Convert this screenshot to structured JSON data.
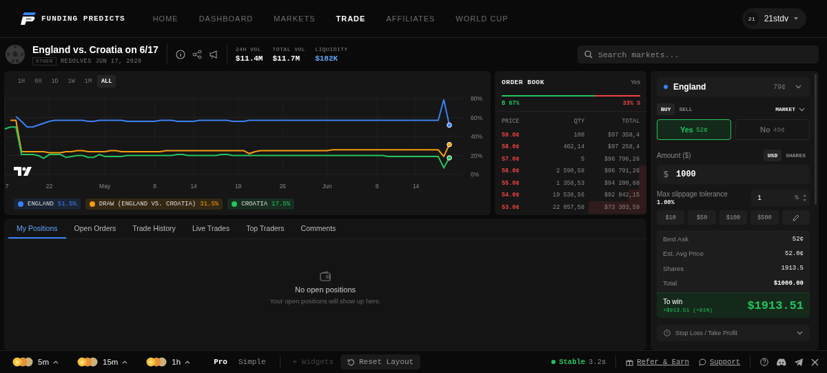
{
  "nav": {
    "brand": "FUNDING PREDICTS",
    "items": [
      {
        "label": "HOME",
        "selected": false
      },
      {
        "label": "DASHBOARD",
        "selected": false
      },
      {
        "label": "MARKETS",
        "selected": false
      },
      {
        "label": "TRADE",
        "selected": true
      },
      {
        "label": "AFFILIATES",
        "selected": false
      },
      {
        "label": "WORLD CUP",
        "selected": false
      }
    ],
    "user": {
      "badge": "21",
      "name": "21stdv"
    }
  },
  "market": {
    "title": "England vs. Croatia on 6/17",
    "category": "OTHER",
    "resolves": "RESOLVES JUN 17, 2026",
    "stats": [
      {
        "label": "24H VOL",
        "value": "$11.4M",
        "kind": "plain"
      },
      {
        "label": "TOTAL VOL",
        "value": "$11.7M",
        "kind": "plain"
      },
      {
        "label": "LIQUIDITY",
        "value": "$182K",
        "kind": "accent"
      }
    ]
  },
  "search": {
    "placeholder": "Search markets..."
  },
  "chart": {
    "ranges": [
      {
        "label": "1H",
        "selected": false
      },
      {
        "label": "6H",
        "selected": false
      },
      {
        "label": "1D",
        "selected": false
      },
      {
        "label": "1W",
        "selected": false
      },
      {
        "label": "1M",
        "selected": false
      },
      {
        "label": "ALL",
        "selected": true
      }
    ],
    "chart_data": {
      "type": "line",
      "categories": [
        "7",
        null,
        null,
        null,
        null,
        null,
        null,
        null,
        "22",
        null,
        null,
        null,
        null,
        null,
        null,
        null,
        null,
        null,
        "May",
        null,
        null,
        null,
        null,
        null,
        null,
        null,
        null,
        "8",
        null,
        null,
        null,
        null,
        null,
        null,
        "14",
        null,
        null,
        null,
        null,
        null,
        null,
        null,
        "19",
        null,
        null,
        null,
        null,
        null,
        null,
        null,
        "26",
        null,
        null,
        null,
        null,
        null,
        null,
        null,
        "Jun",
        null,
        null,
        null,
        null,
        null,
        null,
        null,
        null,
        "8",
        null,
        null,
        null,
        null,
        null,
        null,
        "14",
        null,
        null,
        null,
        null,
        null,
        null
      ],
      "ylim": [
        0,
        80
      ],
      "grid": true,
      "yticks": [
        {
          "value": 0,
          "label": "0%"
        },
        {
          "value": 20,
          "label": "20%"
        },
        {
          "value": 40,
          "label": "40%"
        },
        {
          "value": 60,
          "label": "60%"
        },
        {
          "value": 80,
          "label": "80%"
        }
      ],
      "series": [
        {
          "name": "ENGLAND",
          "color": "#3b82f6",
          "values": [
            null,
            null,
            61,
            56,
            50,
            50,
            52,
            54,
            56,
            57,
            57,
            57,
            57,
            57,
            57,
            56,
            56,
            57,
            57,
            57,
            57,
            57,
            56,
            56,
            56,
            56,
            56,
            56,
            57,
            57,
            57,
            56,
            56,
            56,
            56,
            57,
            57,
            57,
            57,
            57,
            57,
            56,
            56,
            56,
            57,
            57,
            57,
            57,
            57,
            57,
            57,
            57,
            57,
            57,
            57,
            57,
            57,
            57,
            57,
            57,
            57,
            57,
            57,
            57,
            57,
            57,
            57,
            57,
            57,
            57,
            57,
            57,
            57,
            57,
            57,
            57,
            57,
            57,
            57,
            79,
            52
          ]
        },
        {
          "name": "DRAW (ENGLAND VS. CROATIA)",
          "color": "#f59e0b",
          "values": [
            null,
            57,
            57,
            24,
            24,
            24,
            24,
            24,
            23,
            23,
            23,
            24,
            24,
            25,
            25,
            24,
            24,
            24,
            24,
            25,
            25,
            24,
            24,
            24,
            24,
            24,
            24,
            24,
            24,
            25,
            25,
            25,
            25,
            25,
            25,
            25,
            25,
            25,
            25,
            25,
            25,
            25,
            25,
            25,
            22,
            24,
            25,
            25,
            25,
            25,
            25,
            25,
            25,
            25,
            25,
            25,
            25,
            25,
            25,
            26,
            26,
            26,
            26,
            26,
            26,
            26,
            26,
            26,
            26,
            26,
            26,
            26,
            26,
            26,
            26,
            26,
            26,
            26,
            26,
            19,
            31.5
          ]
        },
        {
          "name": "CROATIA",
          "color": "#22c55e",
          "values": [
            48,
            50,
            50,
            21,
            21,
            21,
            20,
            17,
            21,
            21,
            21,
            18,
            19,
            20,
            20,
            18,
            18,
            21,
            19,
            19,
            19,
            19,
            20,
            20,
            20,
            20,
            20,
            20,
            20,
            20,
            20,
            21,
            21,
            20,
            20,
            20,
            20,
            20,
            20,
            21,
            21,
            20,
            20,
            20,
            20,
            20,
            20,
            20,
            20,
            20,
            20,
            20,
            20,
            20,
            20,
            20,
            20,
            20,
            20,
            20,
            20,
            20,
            20,
            20,
            20,
            20,
            20,
            20,
            20,
            19,
            19,
            19,
            19,
            19,
            19,
            19,
            19,
            19,
            19,
            7,
            17.5
          ]
        }
      ]
    },
    "legend_values": [
      "51.5%",
      "31.5%",
      "17.5%"
    ]
  },
  "order_book": {
    "title": "ORDER BOOK",
    "side": "Yes",
    "buy_label": "B 67%",
    "sell_label": "33% S",
    "level": 0.67,
    "columns": [
      "PRICE",
      "QTY",
      "TOTAL"
    ],
    "rows": [
      {
        "price": "59.0¢",
        "qty": "100",
        "total": "$97 358,4",
        "level": 0
      },
      {
        "price": "58.0¢",
        "qty": "462,14",
        "total": "$97 258,4",
        "level": 0
      },
      {
        "price": "57.0¢",
        "qty": "5",
        "total": "$96 796,26",
        "level": 0
      },
      {
        "price": "56.0¢",
        "qty": "2 590,58",
        "total": "$96 791,26",
        "level": 0.05
      },
      {
        "price": "55.0¢",
        "qty": "1 358,53",
        "total": "$94 200,68",
        "level": 0.05
      },
      {
        "price": "54.0¢",
        "qty": "19 538,56",
        "total": "$92 842,15",
        "level": 0.12
      },
      {
        "price": "53.0¢",
        "qty": "22 057,58",
        "total": "$73 303,59",
        "level": 0.38
      }
    ]
  },
  "positions": {
    "tabs": [
      {
        "label": "My Positions",
        "selected": true
      },
      {
        "label": "Open Orders",
        "selected": false
      },
      {
        "label": "Trade History",
        "selected": false
      },
      {
        "label": "Live Trades",
        "selected": false
      },
      {
        "label": "Top Traders",
        "selected": false
      },
      {
        "label": "Comments",
        "selected": false
      }
    ],
    "empty_title": "No open positions",
    "empty_text": "Your open positions will show up here."
  },
  "trade": {
    "outcome": {
      "name": "England",
      "price": "79¢",
      "color": "#3b82f6"
    },
    "sides": [
      {
        "label": "BUY",
        "selected": true
      },
      {
        "label": "SELL",
        "selected": false
      }
    ],
    "order_type": "MARKET",
    "options": [
      {
        "label": "Yes",
        "price": "52¢",
        "selected": true
      },
      {
        "label": "No",
        "price": "49¢",
        "selected": false
      }
    ],
    "amount_label": "Amount ($)",
    "units": [
      {
        "label": "USD",
        "selected": true
      },
      {
        "label": "SHARES",
        "selected": false
      }
    ],
    "currency": "$",
    "amount": "1000",
    "slippage_label": "Max slippage tolerance",
    "slippage_value": "1.00%",
    "slippage_input": "1",
    "slippage_unit": "%",
    "presets": [
      "$10",
      "$50",
      "$100",
      "$500"
    ],
    "summary": [
      {
        "label": "Best Ask",
        "value": "52¢"
      },
      {
        "label": "Est. Avg Price",
        "value": "52.0¢"
      },
      {
        "label": "Shares",
        "value": "1913.5"
      },
      {
        "label": "Total",
        "value": "$1000.00"
      }
    ],
    "to_win_label": "To win",
    "to_win_change": "+$913.51 (+91%)",
    "to_win_value": "$1913.51",
    "stop_loss": "Stop Loss / Take Profit"
  },
  "status_bar": {
    "timeframes": [
      "5m",
      "15m",
      "1h"
    ],
    "modes": [
      {
        "label": "Pro",
        "selected": true
      },
      {
        "label": "Simple",
        "selected": false
      }
    ],
    "widgets": "+ Widgets",
    "reset": "Reset Layout",
    "status": "Stable",
    "latency": "3.2s",
    "refer": "Refer & Earn",
    "support": "Support"
  }
}
